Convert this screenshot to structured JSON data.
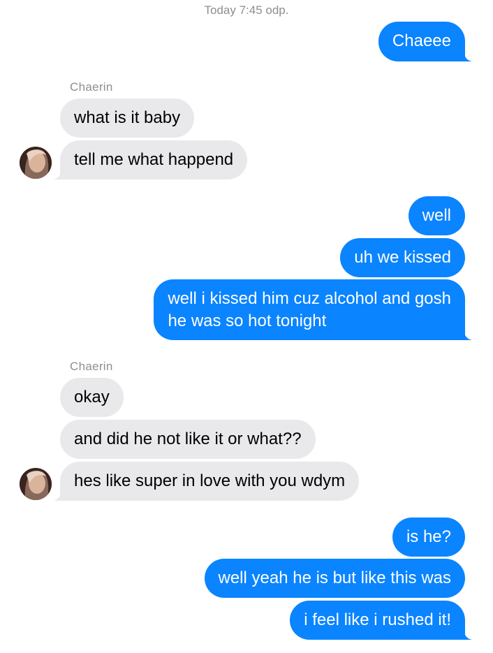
{
  "timestamp": "Today 7:45 odp.",
  "contact": {
    "name": "Chaerin"
  },
  "messages": [
    {
      "from": "me",
      "text": "Chaeee"
    },
    {
      "from": "them",
      "text": "what is it baby"
    },
    {
      "from": "them",
      "text": "tell me what happend"
    },
    {
      "from": "me",
      "text": "well"
    },
    {
      "from": "me",
      "text": "uh we kissed"
    },
    {
      "from": "me",
      "text_lines": [
        "well i kissed him cuz alcohol and gosh",
        "he was so hot tonight"
      ]
    },
    {
      "from": "them",
      "text": "okay"
    },
    {
      "from": "them",
      "text": "and did he not like it or what??"
    },
    {
      "from": "them",
      "text": "hes like super in love with you wdym"
    },
    {
      "from": "me",
      "text": "is he?"
    },
    {
      "from": "me",
      "text": "well yeah he is but like this was"
    },
    {
      "from": "me",
      "text": "i feel like i rushed it!"
    }
  ],
  "colors": {
    "sent_bubble": "#0a84ff",
    "received_bubble": "#e9e9eb",
    "meta_text": "#8e8e93"
  },
  "icons": {
    "avatar": "contact-avatar-photo"
  }
}
